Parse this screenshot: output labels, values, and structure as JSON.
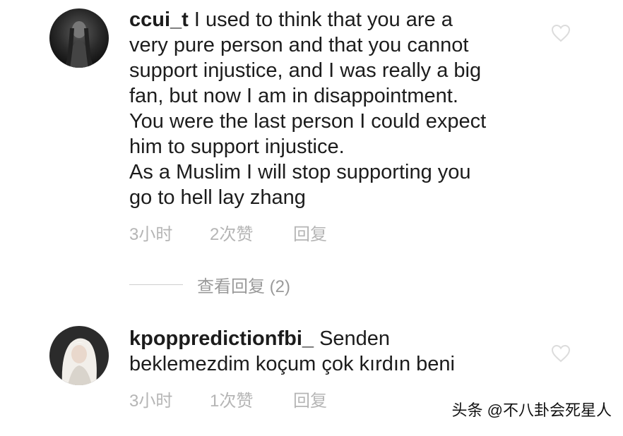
{
  "comments": [
    {
      "username": "ccui_t",
      "text": "I used to think that you are a\nvery pure person and that you cannot\nsupport injustice, and I was really a big\nfan, but now I am in disappointment.\nYou were the last person I could expect\nhim to support injustice.\nAs a Muslim I will stop supporting you\ngo to hell lay zhang",
      "time": "3小时",
      "likes": "2次赞",
      "reply_label": "回复",
      "avatar_icon": "user-avatar-dark"
    },
    {
      "username": "kpoppredictionfbi_",
      "text": "Senden\nbeklemezdim koçum çok kırdın beni",
      "time": "3小时",
      "likes": "1次赞",
      "reply_label": "回复",
      "avatar_icon": "user-avatar-light"
    }
  ],
  "view_replies": {
    "label": "查看回复 (2)"
  },
  "watermark": "头条 @不八卦会死星人",
  "colors": {
    "text": "#1c1c1c",
    "meta": "#b5b5b5",
    "heart": "#dddddd"
  }
}
